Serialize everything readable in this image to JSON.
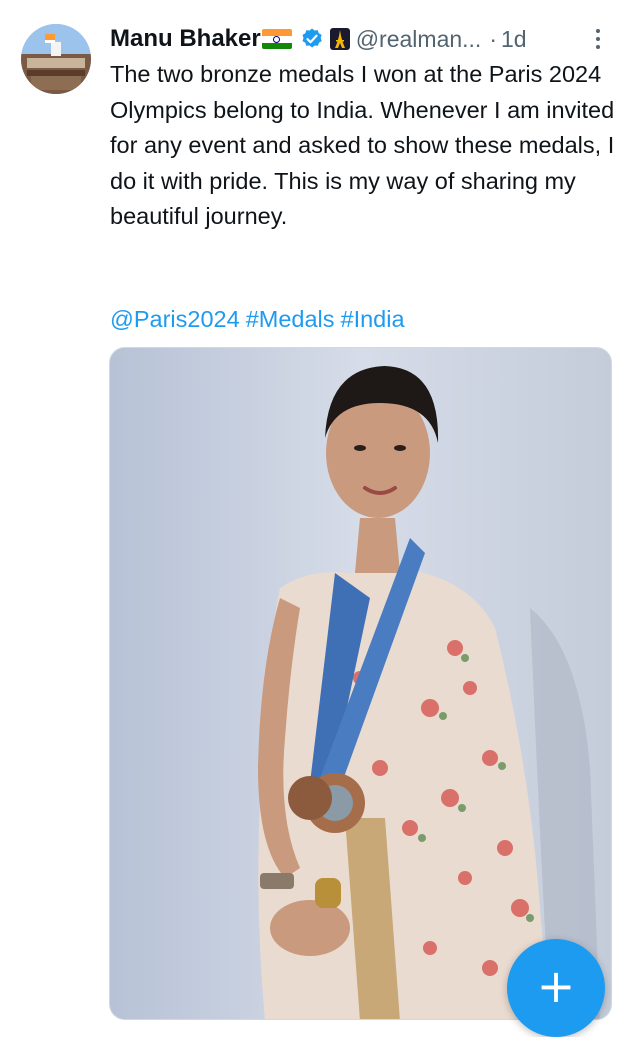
{
  "tweet": {
    "author_name": "Manu Bhaker",
    "handle": "@realman...",
    "separator": "·",
    "time": "1d",
    "text": "The two bronze medals I won at the Paris 2024 Olympics belong to India. Whenever I am invited for any event and asked to show these medals, I do it with pride. This is my way of sharing my beautiful journey.",
    "hashtags": [
      "@Paris2024",
      "#Medals",
      "#India"
    ]
  },
  "icons": {
    "verified": "verified-badge-icon",
    "affiliate": "eiffel-tower-affiliate-icon",
    "more": "more-options-icon",
    "compose": "compose-plus-icon"
  },
  "colors": {
    "accent": "#1d9bf0",
    "text": "#0f1419",
    "muted": "#536471"
  },
  "fab": {
    "label": "+"
  }
}
